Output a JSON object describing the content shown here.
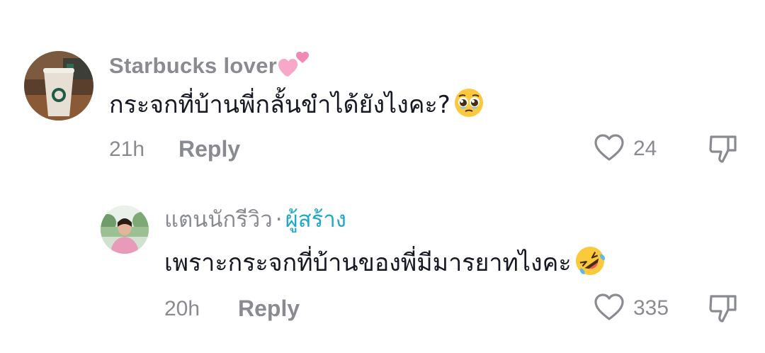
{
  "comments": [
    {
      "username": "Starbucks  lover",
      "username_emoji": "two-hearts",
      "text": "กระจกที่บ้านพี่กลั้นขำได้ยังไงคะ?",
      "text_emoji": "pleading-face",
      "time": "21h",
      "reply_label": "Reply",
      "likes": "24"
    },
    {
      "username": "แตนนักรีวิว",
      "separator": "·",
      "creator_badge": "ผู้สร้าง",
      "text": "เพราะกระจกที่บ้านของพี่มีมารยาทไงคะ",
      "text_emoji": "rolling-on-floor-laughing",
      "time": "20h",
      "reply_label": "Reply",
      "likes": "335"
    }
  ],
  "colors": {
    "meta_gray": "#8a8b91",
    "text": "#161823",
    "creator": "#20a8c8"
  }
}
